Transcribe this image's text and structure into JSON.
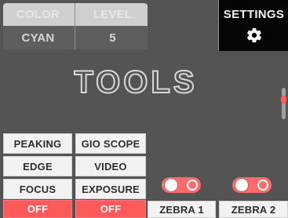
{
  "header": {
    "labels": [
      "COLOR",
      "LEVEL"
    ],
    "values": [
      "CYAN",
      "5"
    ]
  },
  "settings": {
    "title": "SETTINGS",
    "icon": "gear-icon"
  },
  "title": {
    "text": "TOOLS"
  },
  "grid": {
    "rows": [
      [
        "PEAKING",
        "GIO SCOPE"
      ],
      [
        "EDGE",
        "VIDEO"
      ],
      [
        "FOCUS",
        "EXPOSURE"
      ],
      [
        "OFF",
        "OFF"
      ]
    ]
  },
  "zebra": {
    "labels": [
      "ZEBRA 1",
      "ZEBRA 2"
    ]
  },
  "colors": {
    "background": "#545454",
    "accent": "#ff5a5a",
    "settings_bg": "#050505",
    "panel_light": "#f2f2f2",
    "panel_mid": "#cfcfcf"
  }
}
